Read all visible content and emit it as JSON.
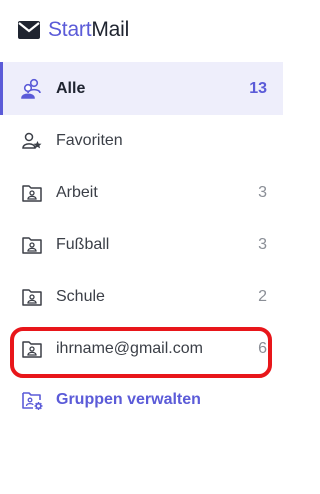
{
  "brand": {
    "part1": "Start",
    "part2": "Mail"
  },
  "nav": {
    "items": [
      {
        "label": "Alle",
        "count": "13",
        "icon": "contacts-group-icon",
        "active": true
      },
      {
        "label": "Favoriten",
        "count": "",
        "icon": "favorite-contact-icon"
      },
      {
        "label": "Arbeit",
        "count": "3",
        "icon": "contact-folder-icon"
      },
      {
        "label": "Fußball",
        "count": "3",
        "icon": "contact-folder-icon"
      },
      {
        "label": "Schule",
        "count": "2",
        "icon": "contact-folder-icon"
      },
      {
        "label": "ihrname@gmail.com",
        "count": "6",
        "icon": "contact-folder-icon"
      }
    ],
    "manage_label": "Gruppen verwalten"
  },
  "colors": {
    "accent": "#5b5bd8",
    "highlight": "#e8161a",
    "active_bg": "#eeeefb"
  }
}
